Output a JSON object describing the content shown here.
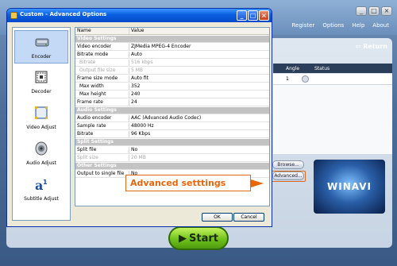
{
  "dialog": {
    "title": "Custom - Advanced Options",
    "buttons": {
      "minimize": "_",
      "maximize": "□",
      "close": "×"
    },
    "ok_label": "OK",
    "cancel_label": "Cancel"
  },
  "sidebar": {
    "items": [
      {
        "label": "Encoder",
        "icon": "encoder-icon",
        "selected": true
      },
      {
        "label": "Decoder",
        "icon": "decoder-icon",
        "selected": false
      },
      {
        "label": "Video Adjust",
        "icon": "video-adjust-icon",
        "selected": false
      },
      {
        "label": "Audio Adjust",
        "icon": "audio-adjust-icon",
        "selected": false
      },
      {
        "label": "Subtitle Adjust",
        "icon": "subtitle-adjust-icon",
        "selected": false
      }
    ]
  },
  "grid": {
    "header": {
      "name": "Name",
      "value": "Value"
    },
    "rows": [
      {
        "type": "section",
        "name": "Video Settings"
      },
      {
        "type": "row",
        "name": "Video encoder",
        "value": "ZJMedia MPEG-4 Encoder"
      },
      {
        "type": "row",
        "name": "Bitrate mode",
        "value": "Auto"
      },
      {
        "type": "row",
        "name": "Bitrate",
        "value": "516 kbps",
        "disabled": true,
        "sub": true
      },
      {
        "type": "row",
        "name": "Output file size",
        "value": "5 MB",
        "disabled": true,
        "sub": true
      },
      {
        "type": "row",
        "name": "Frame size mode",
        "value": "Auto fit"
      },
      {
        "type": "row",
        "name": "Max width",
        "value": "352",
        "sub": true
      },
      {
        "type": "row",
        "name": "Max height",
        "value": "240",
        "sub": true
      },
      {
        "type": "row",
        "name": "Frame rate",
        "value": "24"
      },
      {
        "type": "section",
        "name": "Audio Settings"
      },
      {
        "type": "row",
        "name": "Audio encoder",
        "value": "AAC (Advanced Audio Codec)"
      },
      {
        "type": "row",
        "name": "Sample rate",
        "value": "48000 Hz"
      },
      {
        "type": "row",
        "name": "Bitrate",
        "value": "96 Kbps"
      },
      {
        "type": "section",
        "name": "Split Settings"
      },
      {
        "type": "row",
        "name": "Split file",
        "value": "No"
      },
      {
        "type": "row",
        "name": "Split size",
        "value": "20 MB",
        "disabled": true
      },
      {
        "type": "section",
        "name": "Other Settings"
      },
      {
        "type": "row",
        "name": "Output to single file",
        "value": "No"
      }
    ]
  },
  "app": {
    "window_buttons": [
      "_",
      "□",
      "×"
    ],
    "menu": [
      "Register",
      "Options",
      "Help",
      "About"
    ],
    "return_label": "Return",
    "table": {
      "headers": [
        "Angle",
        "Status"
      ],
      "angle_value": "1"
    },
    "browse_label": "Browse...",
    "advanced_label": "Advanced...",
    "logo_text": "WINAVI",
    "start_label": "Start"
  },
  "callout": {
    "text": "Advanced setttings",
    "color": "#e8650a"
  },
  "colors": {
    "titlebar": "#0a5fe0",
    "section_bg": "#c3c3c3",
    "start_green": "#6fc21c"
  }
}
